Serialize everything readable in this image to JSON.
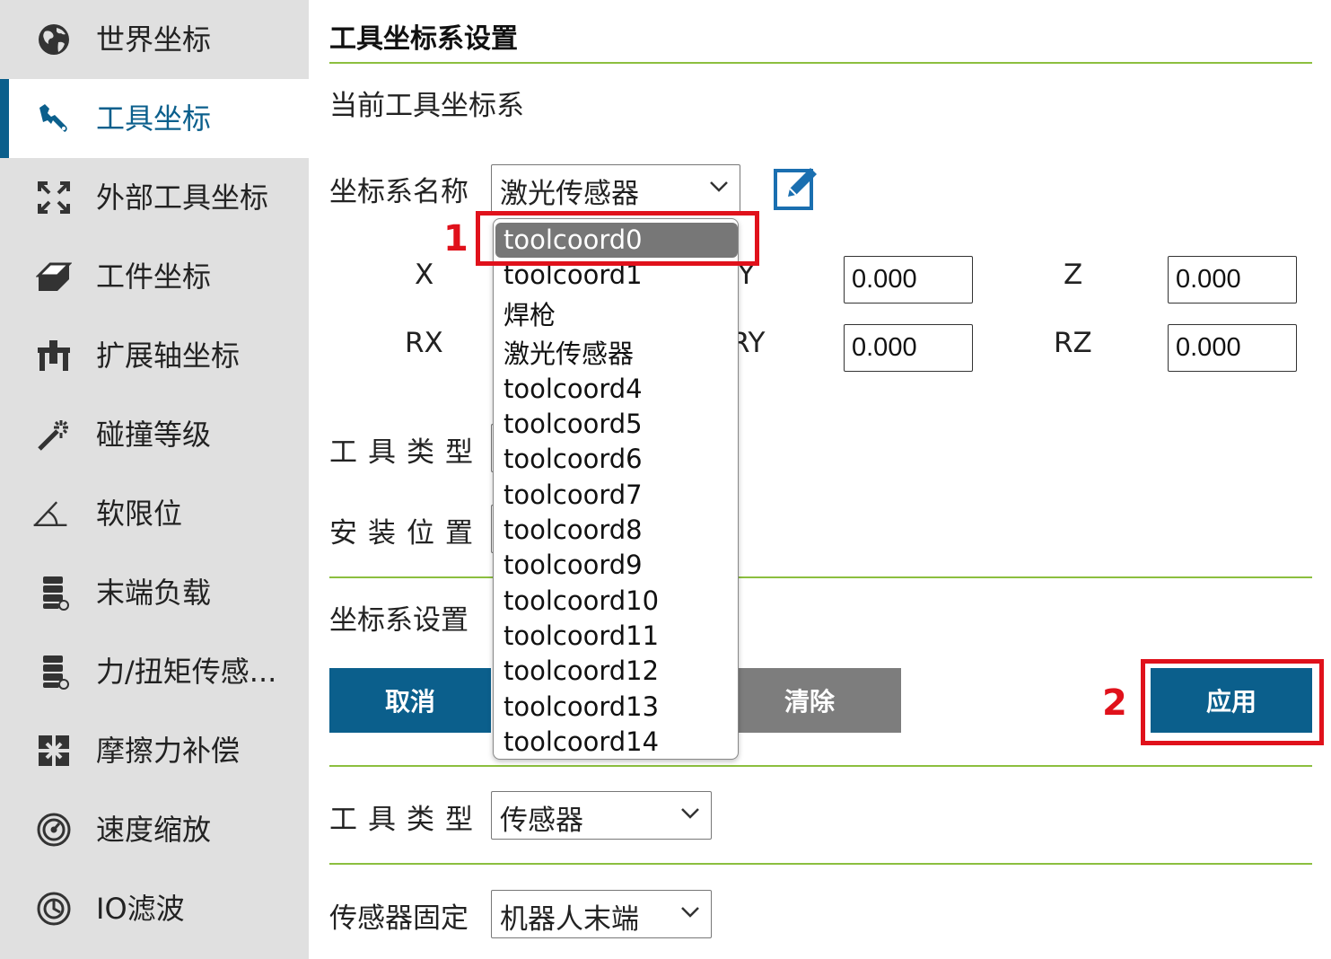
{
  "sidebar": {
    "items": [
      {
        "label": "世界坐标",
        "icon": "globe-icon"
      },
      {
        "label": "工具坐标",
        "icon": "wrench-icon",
        "active": true
      },
      {
        "label": "外部工具坐标",
        "icon": "expand-arrows-icon"
      },
      {
        "label": "工件坐标",
        "icon": "eraser-block-icon"
      },
      {
        "label": "扩展轴坐标",
        "icon": "linear-axis-icon"
      },
      {
        "label": "碰撞等级",
        "icon": "magic-wand-icon"
      },
      {
        "label": "软限位",
        "icon": "angle-limit-icon"
      },
      {
        "label": "末端负载",
        "icon": "payload-stack-icon"
      },
      {
        "label": "力/扭矩传感...",
        "icon": "force-sensor-icon"
      },
      {
        "label": "摩擦力补偿",
        "icon": "friction-grid-icon"
      },
      {
        "label": "速度缩放",
        "icon": "speedometer-icon"
      },
      {
        "label": "IO滤波",
        "icon": "io-filter-icon"
      }
    ]
  },
  "main": {
    "title": "工具坐标系设置",
    "current_label": "当前工具坐标系",
    "coord_name_label": "坐标系名称",
    "coord_name_value": "激光传感器",
    "fields": {
      "x_label": "X",
      "y_label": "Y",
      "y_value": "0.000",
      "z_label": "Z",
      "z_value": "0.000",
      "rx_label": "RX",
      "ry_label": "RY",
      "ry_value": "0.000",
      "rz_label": "RZ",
      "rz_value": "0.000"
    },
    "tool_type_label": "工具类型",
    "install_pos_label": "安装位置",
    "coord_setting_label": "坐标系设置",
    "buttons": {
      "cancel": "取消",
      "clear": "清除",
      "apply": "应用"
    },
    "tool_type2_label": "工具类型",
    "tool_type2_value": "传感器",
    "sensor_fixed_label": "传感器固定",
    "sensor_fixed_value": "机器人末端"
  },
  "dropdown": {
    "options": [
      "toolcoord0",
      "toolcoord1",
      "焊枪",
      "激光传感器",
      "toolcoord4",
      "toolcoord5",
      "toolcoord6",
      "toolcoord7",
      "toolcoord8",
      "toolcoord9",
      "toolcoord10",
      "toolcoord11",
      "toolcoord12",
      "toolcoord13",
      "toolcoord14"
    ],
    "selected": "toolcoord0"
  },
  "annotations": {
    "marker1": "1",
    "marker2": "2",
    "color": "#e0111b"
  },
  "colors": {
    "accent": "#0b5f8c",
    "divider": "#8cbf3f",
    "sidebar_bg": "#e0e0e0"
  }
}
